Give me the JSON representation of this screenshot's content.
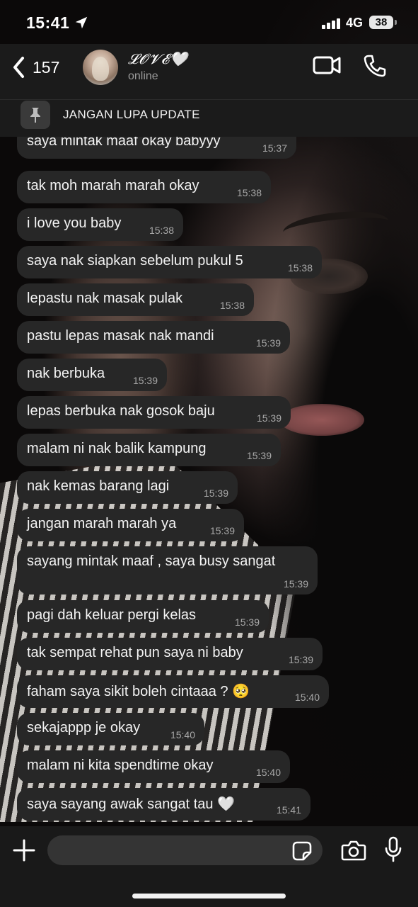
{
  "status_bar": {
    "time": "15:41",
    "network": "4G",
    "battery": "38"
  },
  "header": {
    "back_count": "157",
    "contact_name": "𝓛𝓞𝓥𝓔🤍",
    "contact_status": "online"
  },
  "pinned": {
    "text": "JANGAN LUPA UPDATE"
  },
  "messages": [
    {
      "text": "saya mintak maaf okay babyyy",
      "time": "15:37"
    },
    {
      "text": "tak moh marah marah okay",
      "time": "15:38"
    },
    {
      "text": "i love you baby",
      "time": "15:38"
    },
    {
      "text": "saya nak siapkan sebelum pukul 5",
      "time": "15:38"
    },
    {
      "text": "lepastu nak masak pulak",
      "time": "15:38"
    },
    {
      "text": "pastu lepas masak nak mandi",
      "time": "15:39"
    },
    {
      "text": "nak berbuka",
      "time": "15:39"
    },
    {
      "text": "lepas berbuka nak gosok baju",
      "time": "15:39"
    },
    {
      "text": "malam ni nak balik kampung",
      "time": "15:39"
    },
    {
      "text": "nak kemas barang lagi",
      "time": "15:39"
    },
    {
      "text": "jangan marah marah ya",
      "time": "15:39"
    },
    {
      "text": "sayang mintak maaf , saya busy sangat",
      "time": "15:39"
    },
    {
      "text": "pagi dah keluar pergi kelas",
      "time": "15:39"
    },
    {
      "text": "tak sempat rehat pun saya ni baby",
      "time": "15:39"
    },
    {
      "text": "faham saya sikit boleh cintaaa ? 🥺",
      "time": "15:40"
    },
    {
      "text": "sekajappp je okay",
      "time": "15:40"
    },
    {
      "text": "malam ni kita spendtime okay",
      "time": "15:40"
    },
    {
      "text": "saya sayang awak sangat tau 🤍",
      "time": "15:41"
    }
  ],
  "icons": {
    "location": "location-arrow-icon",
    "back": "chevron-left-icon",
    "video": "video-camera-icon",
    "call": "phone-icon",
    "pin": "pin-icon",
    "attach": "plus-icon",
    "sticker": "sticker-icon",
    "camera": "camera-icon",
    "mic": "microphone-icon"
  },
  "colors": {
    "bubble": "#272727",
    "bar": "#1c1c1c",
    "timestamp": "#a8a8a8"
  }
}
